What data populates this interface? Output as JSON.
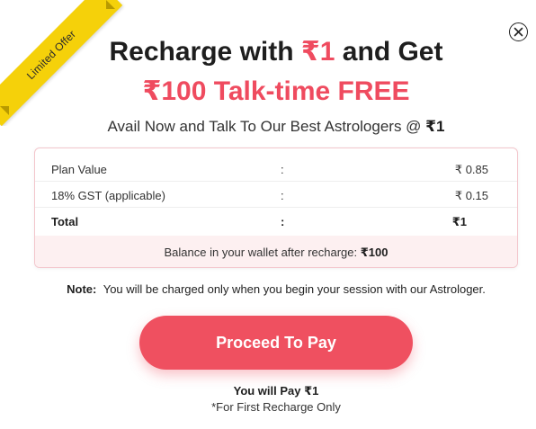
{
  "ribbon": {
    "label": "Limited Offer",
    "color": "#f5d10a"
  },
  "close": {
    "icon": "close-icon"
  },
  "title": {
    "line1_prefix": "Recharge with ",
    "line1_accent": "₹1",
    "line1_suffix": " and Get",
    "line2": "₹100 Talk-time FREE",
    "accent_color": "#ef4b5f"
  },
  "subtitle": {
    "text": "Avail Now and Talk To Our Best Astrologers @ ",
    "amount": "₹1"
  },
  "plan": {
    "rows": [
      {
        "label": "Plan Value",
        "separator": ":",
        "value": "₹ 0.85"
      },
      {
        "label": "18% GST (applicable)",
        "separator": ":",
        "value": "₹ 0.15"
      },
      {
        "label": "Total",
        "separator": ":",
        "value": "₹1"
      }
    ],
    "balance_text": "Balance in your wallet after recharge: ",
    "balance_amount": "₹100"
  },
  "note": {
    "label": "Note:",
    "text": "You will be charged only when you begin your session with our Astrologer."
  },
  "cta": {
    "label": "Proceed To Pay",
    "color": "#ef5060"
  },
  "footer": {
    "pay_text": "You will Pay ₹1",
    "first_recharge": "*For First Recharge Only"
  }
}
